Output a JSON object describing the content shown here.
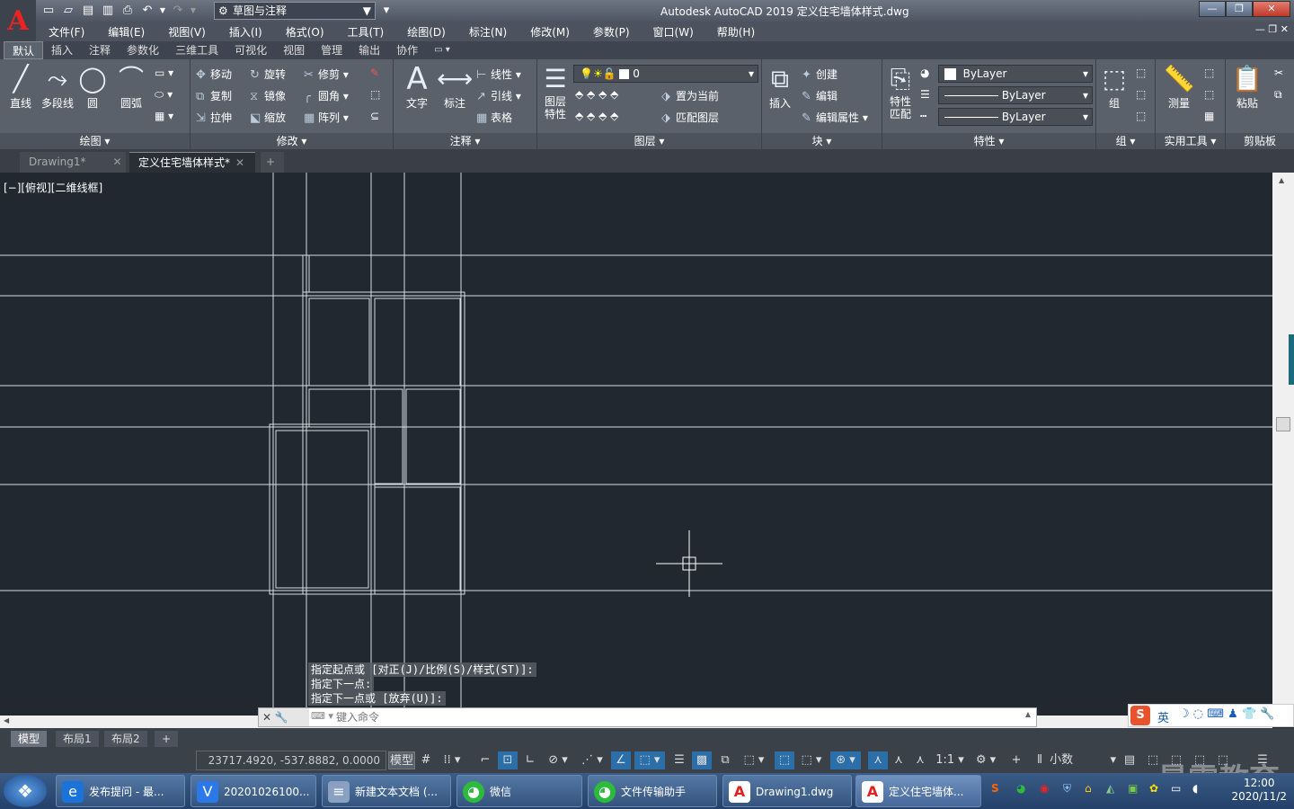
{
  "title_bar": {
    "app_title": "Autodesk AutoCAD 2019    定义住宅墙体样式.dwg",
    "workspace": "草图与注释"
  },
  "menu": [
    "文件(F)",
    "编辑(E)",
    "视图(V)",
    "插入(I)",
    "格式(O)",
    "工具(T)",
    "绘图(D)",
    "标注(N)",
    "修改(M)",
    "参数(P)",
    "窗口(W)",
    "帮助(H)"
  ],
  "ribbon_tabs": [
    "默认",
    "插入",
    "注释",
    "参数化",
    "三维工具",
    "可视化",
    "视图",
    "管理",
    "输出",
    "协作"
  ],
  "draw_panel": {
    "title": "绘图",
    "line": "直线",
    "polyline": "多段线",
    "circle": "圆",
    "arc": "圆弧"
  },
  "modify_panel": {
    "title": "修改",
    "move": "移动",
    "rotate": "旋转",
    "trim": "修剪",
    "copy": "复制",
    "mirror": "镜像",
    "fillet": "圆角",
    "stretch": "拉伸",
    "scale": "缩放",
    "array": "阵列"
  },
  "annotation_panel": {
    "title": "注释",
    "text": "文字",
    "dimension": "标注",
    "linear": "线性",
    "leader": "引线",
    "table": "表格"
  },
  "layers_panel": {
    "title": "图层",
    "layer_props": "图层",
    "layer_props2": "特性",
    "layer_value": "0",
    "set_current": "置为当前",
    "match_layer": "匹配图层"
  },
  "block_panel": {
    "title": "块",
    "insert": "插入",
    "create": "创建",
    "edit": "编辑",
    "edit_attr": "编辑属性"
  },
  "properties_panel": {
    "title": "特性",
    "match": "特性",
    "match2": "匹配",
    "color": "ByLayer",
    "linetype": "ByLayer",
    "lineweight": "ByLayer"
  },
  "groups_panel": {
    "title": "组",
    "group": "组"
  },
  "utilities_panel": {
    "title": "实用工具",
    "measure": "测量"
  },
  "clipboard_panel": {
    "title": "剪贴板",
    "paste": "粘贴"
  },
  "doc_tabs": [
    "Drawing1*",
    "定义住宅墙体样式*"
  ],
  "viewport_label": "[−][俯视][二维线框]",
  "command_history": [
    "指定起点或 [对正(J)/比例(S)/样式(ST)]:",
    "指定下一点:",
    "指定下一点或 [放弃(U)]:"
  ],
  "command_placeholder": "键入命令",
  "layout_tabs": [
    "模型",
    "布局1",
    "布局2"
  ],
  "status": {
    "coords": "23717.4920, -537.8882, 0.0000",
    "model": "模型",
    "scale": "1:1",
    "units": "小数"
  },
  "taskbar": [
    {
      "label": "发布提问 - 最...",
      "color": "#1a73d9",
      "icon": "e"
    },
    {
      "label": "20201026100...",
      "color": "#2b79e8",
      "icon": "V"
    },
    {
      "label": "新建文本文档 (...",
      "color": "#8aa0c0",
      "icon": "≡"
    },
    {
      "label": "微信",
      "color": "#2dbb3c",
      "icon": "◕"
    },
    {
      "label": "文件传输助手",
      "color": "#2dbb3c",
      "icon": "◕"
    },
    {
      "label": "Drawing1.dwg",
      "color": "#d22",
      "icon": "A"
    },
    {
      "label": "定义住宅墙体...",
      "color": "#d22",
      "icon": "A"
    }
  ],
  "clock": {
    "time": "12:00",
    "date": "2020/11/2"
  },
  "ime_label": "英",
  "watermark": "最需教育"
}
